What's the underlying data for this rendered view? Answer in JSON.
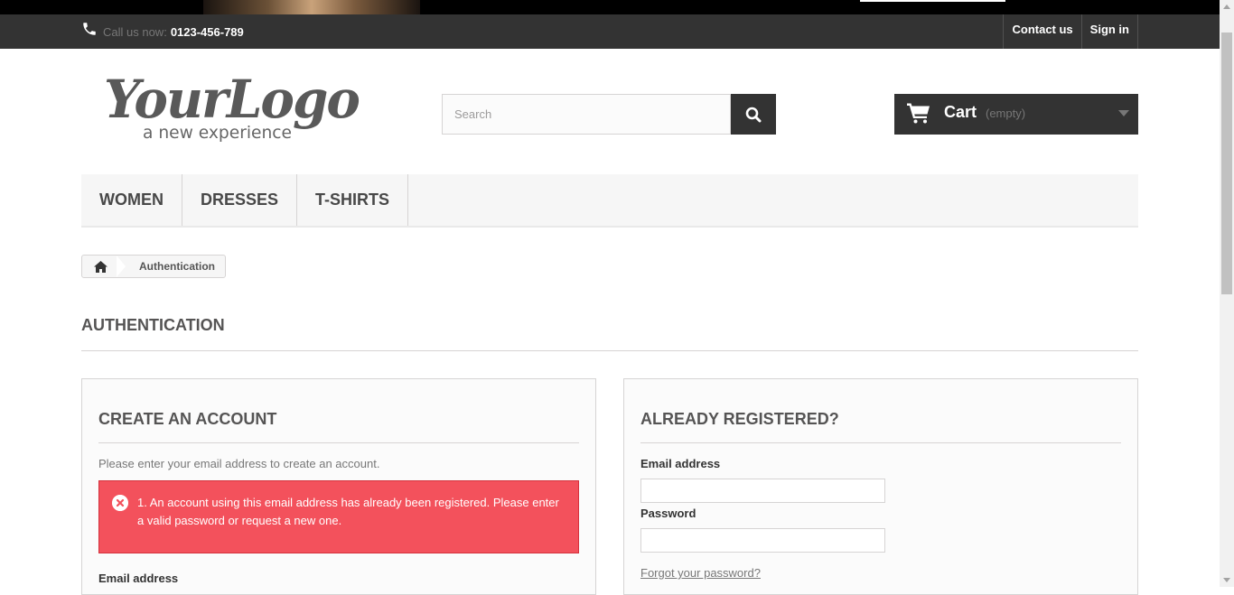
{
  "header": {
    "call_label": "Call us now:",
    "phone_number": "0123-456-789",
    "contact_link": "Contact us",
    "signin_link": "Sign in"
  },
  "logo": {
    "main_text": "YourLogo",
    "tagline": "a new experience"
  },
  "search": {
    "placeholder": "Search",
    "button_icon": "search-icon"
  },
  "cart": {
    "label": "Cart",
    "status": "(empty)",
    "icon": "cart-icon"
  },
  "menu": {
    "items": [
      {
        "label": "WOMEN"
      },
      {
        "label": "DRESSES"
      },
      {
        "label": "T-SHIRTS"
      }
    ]
  },
  "breadcrumb": {
    "home_icon": "home-icon",
    "current": "Authentication"
  },
  "page": {
    "heading": "AUTHENTICATION"
  },
  "create_account": {
    "title": "CREATE AN ACCOUNT",
    "intro": "Please enter your email address to create an account.",
    "error_message": "1. An account using this email address has already been registered. Please enter a valid password or request a new one.",
    "email_label": "Email address"
  },
  "login": {
    "title": "ALREADY REGISTERED?",
    "email_label": "Email address",
    "password_label": "Password",
    "forgot_link": "Forgot your password?"
  },
  "colors": {
    "dark_bar": "#333333",
    "alert_red": "#f3515c",
    "panel_bg": "#fbfbfb",
    "border": "#d6d4d4"
  }
}
